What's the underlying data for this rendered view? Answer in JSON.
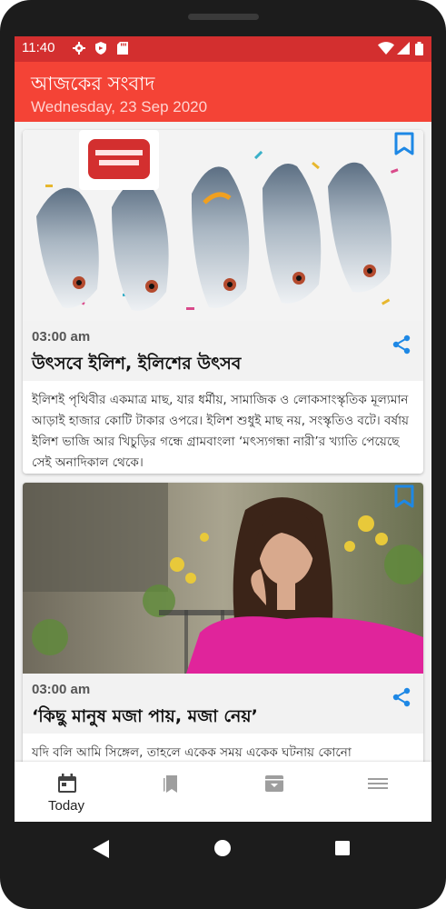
{
  "status_bar": {
    "time": "11:40"
  },
  "app_bar": {
    "title": "আজকের সংবাদ",
    "date": "Wednesday, 23 Sep 2020"
  },
  "articles": [
    {
      "time": "03:00 am",
      "title": "উৎসবে ইলিশ, ইলিশের উৎসব",
      "summary": "ইলিশই পৃথিবীর একমাত্র মাছ, যার ধর্মীয়, সামাজিক ও লোকসাংস্কৃতিক মূল্যমান আড়াই হাজার কোটি টাকার ওপরে। ইলিশ শুধুই মাছ নয়, সংস্কৃতিও বটে। বর্ষায় ইলিশ ভাজি আর খিচুড়ির গন্ধে গ্রামবাংলা ‘মৎস্যগন্ধা নারী’র খ্যাতি পেয়েছে সেই অনাদিকাল থেকে।"
    },
    {
      "time": "03:00 am",
      "title": "‘কিছু মানুষ মজা পায়, মজা নেয়’",
      "summary": "যদি বলি আমি সিঙ্গেল, তাহলে একেক সময় একেক ঘটনায় কোনো"
    }
  ],
  "bottom_nav": [
    {
      "label": "Today",
      "icon": "calendar-icon"
    },
    {
      "label": "",
      "icon": "bookmarks-icon"
    },
    {
      "label": "",
      "icon": "archive-icon"
    },
    {
      "label": "",
      "icon": "menu-icon"
    }
  ],
  "colors": {
    "status_bar": "#d32f2f",
    "app_bar": "#f44336",
    "accent": "#1e88e5"
  }
}
